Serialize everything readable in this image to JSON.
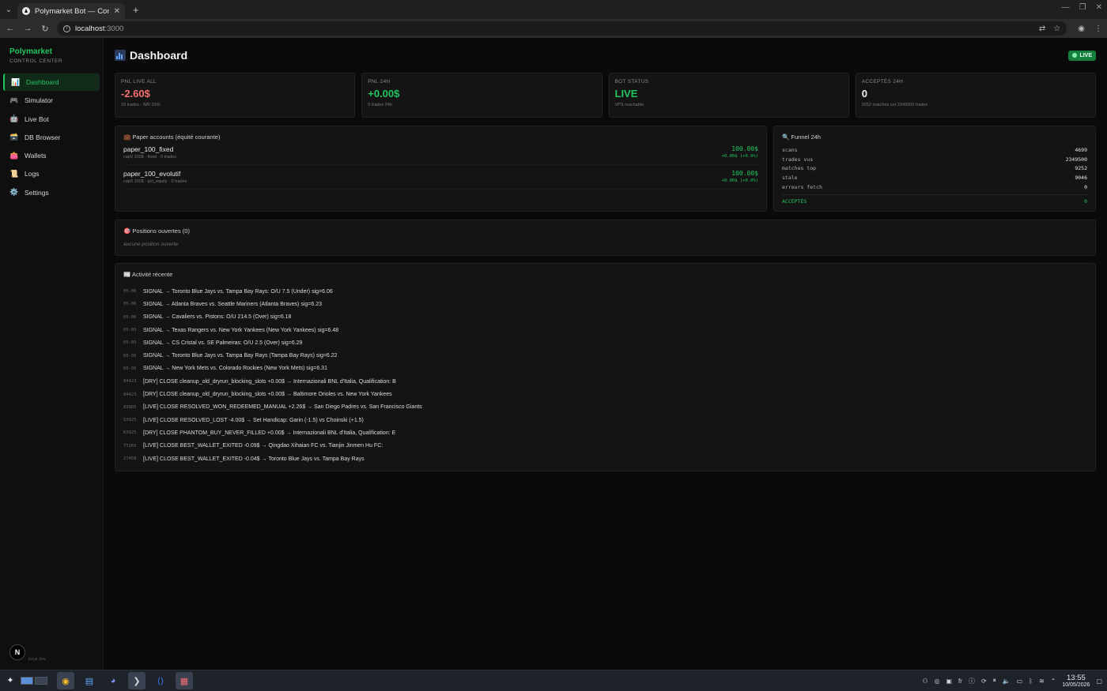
{
  "browser": {
    "tab_title": "Polymarket Bot — Control C",
    "url_host": "localhost",
    "url_port": ":3000"
  },
  "sidebar": {
    "brand": "Polymarket",
    "subtitle": "CONTROL CENTER",
    "items": [
      {
        "icon": "📊",
        "label": "Dashboard"
      },
      {
        "icon": "🎮",
        "label": "Simulator"
      },
      {
        "icon": "🤖",
        "label": "Live Bot"
      },
      {
        "icon": "🗃️",
        "label": "DB Browser"
      },
      {
        "icon": "👛",
        "label": "Wallets"
      },
      {
        "icon": "📜",
        "label": "Logs"
      },
      {
        "icon": "⚙️",
        "label": "Settings"
      }
    ],
    "footer": "local dev",
    "badge": "N"
  },
  "header": {
    "title": "Dashboard",
    "live_badge": "LIVE"
  },
  "stats": [
    {
      "label": "PNL LIVE ALL",
      "value": "-2.60$",
      "sub": "15 trades · WR 33%",
      "color": "#f87171"
    },
    {
      "label": "PNL 24H",
      "value": "+0.00$",
      "sub": "0 trades 24h",
      "color": "#22c55e"
    },
    {
      "label": "BOT STATUS",
      "value": "LIVE",
      "sub": "VPS reachable",
      "color": "#22c55e"
    },
    {
      "label": "ACCEPTÉS 24H",
      "value": "0",
      "sub": "9252 matches sur 2349500 trades",
      "color": "#f2f2f2"
    }
  ],
  "paper": {
    "title": "💼 Paper accounts (équité courante)",
    "accounts": [
      {
        "name": "paper_100_fixed",
        "meta": "cap0 100$ · fixed · 0 trades",
        "equity": "100.00$",
        "change": "+0.00$ (+0.0%)"
      },
      {
        "name": "paper_100_evolutif",
        "meta": "cap0 100$ · pct_equity · 0 trades",
        "equity": "100.00$",
        "change": "+0.00$ (+0.0%)"
      }
    ]
  },
  "funnel": {
    "title": "🔍 Funnel 24h",
    "rows": [
      {
        "label": "scans",
        "value": "4699"
      },
      {
        "label": "trades vus",
        "value": "2349500"
      },
      {
        "label": "matches top",
        "value": "9252"
      },
      {
        "label": "stale",
        "value": "9046"
      },
      {
        "label": "erreurs fetch",
        "value": "0"
      }
    ],
    "total_label": "ACCEPTÉS",
    "total_value": "0"
  },
  "positions": {
    "title": "🎯 Positions ouvertes (0)",
    "empty": "aucune position ouverte"
  },
  "activity": {
    "title": "📰 Activité récente",
    "items": [
      {
        "id": "05-06",
        "text": "SIGNAL → Toronto Blue Jays vs. Tampa Bay Rays: O/U 7.5 (Under) sig=6.06"
      },
      {
        "id": "05-06",
        "text": "SIGNAL → Atlanta Braves vs. Seattle Mariners (Atlanta Braves) sig=6.23"
      },
      {
        "id": "05-06",
        "text": "SIGNAL → Cavaliers vs. Pistons: O/U 214.5 (Over) sig=6.18"
      },
      {
        "id": "05-05",
        "text": "SIGNAL → Texas Rangers vs. New York Yankees (New York Yankees) sig=6.48"
      },
      {
        "id": "05-05",
        "text": "SIGNAL → CS Cristal vs. SE Palmeiras: O/U 2.5 (Over) sig=6.29"
      },
      {
        "id": "05-05",
        "text": "SIGNAL → Toronto Blue Jays vs. Tampa Bay Rays (Tampa Bay Rays) sig=6.22"
      },
      {
        "id": "05-05",
        "text": "SIGNAL → New York Mets vs. Colorado Rockies (New York Mets) sig=6.31"
      },
      {
        "id": "84423",
        "text": "[DRY] CLOSE cleanup_old_dryrun_blocking_slots +0.00$ → Internazionali BNL d'Italia, Qualification: B"
      },
      {
        "id": "84423",
        "text": "[DRY] CLOSE cleanup_old_dryrun_blocking_slots +0.00$ → Baltimore Orioles vs. New York Yankees"
      },
      {
        "id": "83905",
        "text": "[LIVE] CLOSE RESOLVED_WON_REDEEMED_MANUAL +2.26$ → San Diego Padres vs. San Francisco Giants"
      },
      {
        "id": "53925",
        "text": "[LIVE] CLOSE RESOLVED_LOST -4.00$ → Set Handicap: Garin (-1.5) vs Choinski (+1.5)"
      },
      {
        "id": "63925",
        "text": "[DRY] CLOSE PHANTOM_BUY_NEVER_FILLED +0.00$ → Internazionali BNL d'Italia, Qualification: E"
      },
      {
        "id": "77265",
        "text": "[LIVE] CLOSE BEST_WALLET_EXITED -0.09$ → Qingdao Xihaian FC vs. Tianjin Jinmen Hu FC:"
      },
      {
        "id": "27458",
        "text": "[LIVE] CLOSE BEST_WALLET_EXITED -0.04$ → Toronto Blue Jays vs. Tampa Bay Rays"
      }
    ]
  },
  "taskbar": {
    "lang": "fr",
    "time": "13:55",
    "date": "10/05/2026"
  }
}
